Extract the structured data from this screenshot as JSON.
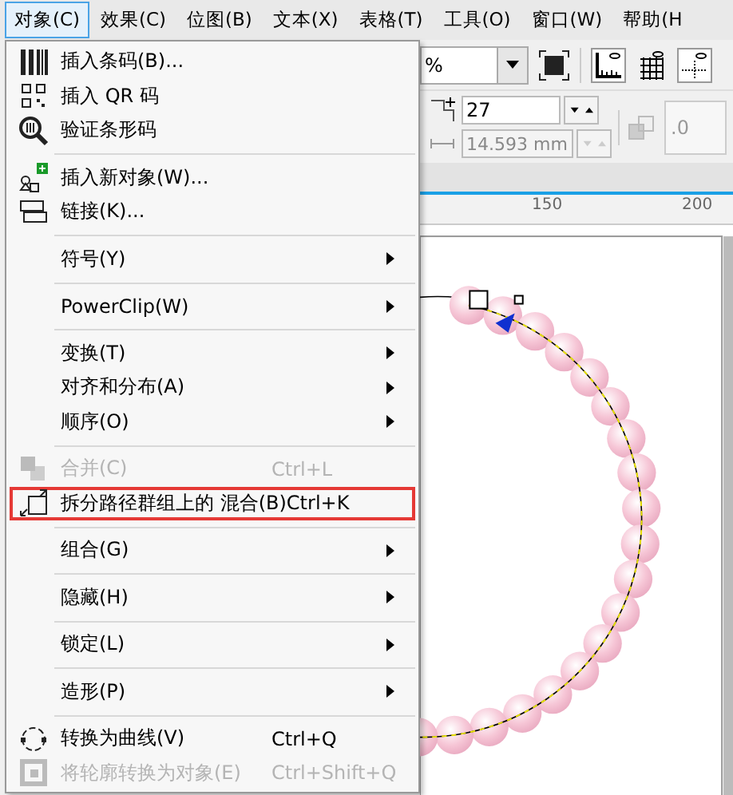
{
  "menubar": [
    {
      "label": "对象(C)",
      "selected": true
    },
    {
      "label": "效果(C)",
      "selected": false
    },
    {
      "label": "位图(B)",
      "selected": false
    },
    {
      "label": "文本(X)",
      "selected": false
    },
    {
      "label": "表格(T)",
      "selected": false
    },
    {
      "label": "工具(O)",
      "selected": false
    },
    {
      "label": "窗口(W)",
      "selected": false
    },
    {
      "label": "帮助(H",
      "selected": false
    }
  ],
  "toolbar": {
    "zoom_field": {
      "value": "%"
    },
    "steps_field": {
      "value": "27"
    },
    "spacing_field": {
      "value": "14.593 mm",
      "disabled": true
    },
    "offset_field": {
      "value": ".0",
      "disabled": true
    }
  },
  "ruler": {
    "labels": [
      "150",
      "200"
    ]
  },
  "menu": {
    "items": [
      {
        "kind": "barcode",
        "label": "插入条码(B)...",
        "disabled": false,
        "selected": false
      },
      {
        "kind": "qr",
        "label": "插入 QR 码",
        "disabled": false,
        "selected": false
      },
      {
        "kind": "verify",
        "label": "验证条形码",
        "disabled": false,
        "selected": false
      },
      {
        "kind": "separator"
      },
      {
        "kind": "insert",
        "label": "插入新对象(W)...",
        "disabled": false,
        "selected": false
      },
      {
        "kind": "ole",
        "label": "链接(K)...",
        "disabled": false,
        "selected": false
      },
      {
        "kind": "separator"
      },
      {
        "kind": "item",
        "label": "符号(Y)",
        "submenu": true,
        "disabled": false,
        "selected": false
      },
      {
        "kind": "separator"
      },
      {
        "kind": "item",
        "label": "PowerClip(W)",
        "submenu": true,
        "disabled": false,
        "selected": false
      },
      {
        "kind": "separator"
      },
      {
        "kind": "item",
        "label": "变换(T)",
        "submenu": true,
        "disabled": false,
        "selected": false
      },
      {
        "kind": "item",
        "label": "对齐和分布(A)",
        "submenu": true,
        "disabled": false,
        "selected": false
      },
      {
        "kind": "item",
        "label": "顺序(O)",
        "submenu": true,
        "disabled": false,
        "selected": false
      },
      {
        "kind": "separator"
      },
      {
        "kind": "combine",
        "label": "合并(C)",
        "shortcut": "Ctrl+L",
        "disabled": true,
        "selected": false
      },
      {
        "kind": "break",
        "label": "拆分路径群组上的 混合(B)",
        "shortcut": "Ctrl+K",
        "disabled": false,
        "selected": true
      },
      {
        "kind": "separator"
      },
      {
        "kind": "item",
        "label": "组合(G)",
        "submenu": true,
        "disabled": false,
        "selected": false
      },
      {
        "kind": "separator"
      },
      {
        "kind": "item",
        "label": "隐藏(H)",
        "submenu": true,
        "disabled": false,
        "selected": false
      },
      {
        "kind": "separator"
      },
      {
        "kind": "item",
        "label": "锁定(L)",
        "submenu": true,
        "disabled": false,
        "selected": false
      },
      {
        "kind": "separator"
      },
      {
        "kind": "item",
        "label": "造形(P)",
        "submenu": true,
        "disabled": false,
        "selected": false
      },
      {
        "kind": "separator"
      },
      {
        "kind": "convert",
        "label": "转换为曲线(V)",
        "shortcut": "Ctrl+Q",
        "disabled": false,
        "selected": false
      },
      {
        "kind": "outline",
        "label": "将轮廓转换为对象(E)",
        "shortcut": "Ctrl+Shift+Q",
        "disabled": true,
        "selected": false
      }
    ]
  }
}
